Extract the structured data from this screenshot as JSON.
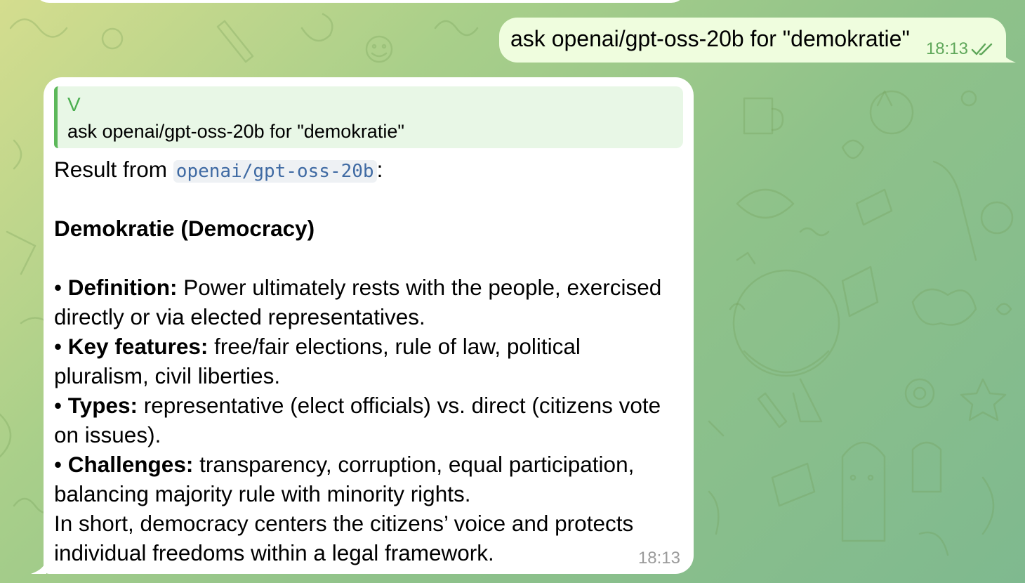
{
  "previous_bubble": {
    "visible": true
  },
  "outgoing_message": {
    "text": "ask openai/gpt-oss-20b for \"demokratie\"",
    "time": "18:13",
    "status_icon": "double-check-icon",
    "status_color": "#5fa75a"
  },
  "incoming_message": {
    "reply": {
      "author": "V",
      "text": "ask openai/gpt-oss-20b for \"demokratie\""
    },
    "result_prefix": "Result from ",
    "model_code": "openai/gpt-oss-20b",
    "result_suffix": ":",
    "heading": "Demokratie (Democracy)",
    "bullet_char": "• ",
    "definition": {
      "label": "Definition:",
      "line1": " Power ultimately rests with the people, exercised",
      "line2": "directly or via elected representatives."
    },
    "key_features": {
      "label": "Key features:",
      "line1": " free/fair elections, rule of law, political",
      "line2": "pluralism, civil liberties."
    },
    "types": {
      "label": "Types:",
      "line1": " representative (elect officials) vs. direct (citizens vote",
      "line2": "on issues)."
    },
    "challenges": {
      "label": "Challenges:",
      "line1": " transparency, corruption, equal participation,",
      "line2": "balancing majority rule with minority rights."
    },
    "summary": {
      "line1": "In short, democracy centers the citizens’ voice and protects",
      "line2": "individual freedoms within a legal framework."
    },
    "time": "18:13"
  },
  "colors": {
    "outgoing_bubble": "#effdde",
    "incoming_bubble": "#ffffff",
    "reply_accent": "#5cb85a",
    "code_text": "#3f6aa3"
  }
}
